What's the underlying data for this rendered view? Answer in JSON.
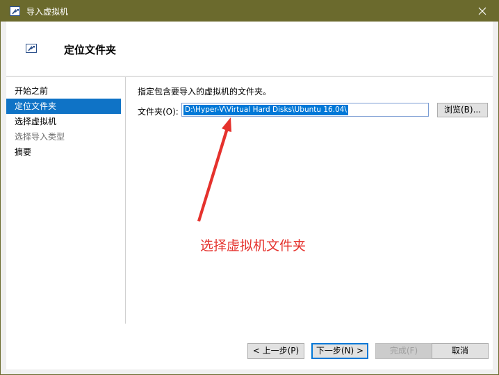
{
  "window": {
    "title": "导入虚拟机",
    "close_glyph": "✕"
  },
  "header": {
    "title": "定位文件夹"
  },
  "nav": {
    "items": [
      {
        "label": "开始之前",
        "state": "normal"
      },
      {
        "label": "定位文件夹",
        "state": "selected"
      },
      {
        "label": "选择虚拟机",
        "state": "normal"
      },
      {
        "label": "选择导入类型",
        "state": "disabled"
      },
      {
        "label": "摘要",
        "state": "normal"
      }
    ]
  },
  "content": {
    "instruction": "指定包含要导入的虚拟机的文件夹。",
    "folder_label": "文件夹(O):",
    "folder_value": "D:\\Hyper-V\\Virtual Hard Disks\\Ubuntu 16.04\\",
    "browse_label": "浏览(B)..."
  },
  "annotation": {
    "text": "选择虚拟机文件夹",
    "color": "#e5322d"
  },
  "footer": {
    "prev_label": "< 上一步(P)",
    "next_label": "下一步(N) >",
    "finish_label": "完成(F)",
    "cancel_label": "取消"
  },
  "colors": {
    "titlebar": "#6b6a2d",
    "selection": "#0f73c6"
  }
}
